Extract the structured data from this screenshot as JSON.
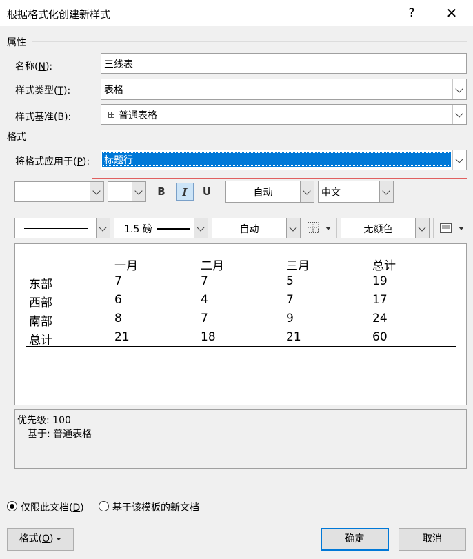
{
  "window": {
    "title": "根据格式化创建新样式",
    "help": "?",
    "close": "✕"
  },
  "properties": {
    "section": "属性",
    "name_label": "名称(",
    "name_key": "N",
    "name_tail": "):",
    "name_value": "三线表",
    "type_label": "样式类型(",
    "type_key": "T",
    "type_tail": "):",
    "type_value": "表格",
    "base_label": "样式基准(",
    "base_key": "B",
    "base_tail": "):",
    "base_value": "普通表格"
  },
  "format": {
    "section": "格式",
    "apply_label": "将格式应用于(",
    "apply_key": "P",
    "apply_tail": "):",
    "apply_value": "标题行",
    "bold": "B",
    "italic": "I",
    "underline": "U",
    "font_color": "自动",
    "script": "中文",
    "border_weight": "1.5 磅",
    "border_color": "自动",
    "shading": "无颜色"
  },
  "preview": {
    "headers": [
      "一月",
      "二月",
      "三月",
      "总计"
    ],
    "rows": [
      [
        "东部",
        "7",
        "7",
        "5",
        "19"
      ],
      [
        "西部",
        "6",
        "4",
        "7",
        "17"
      ],
      [
        "南部",
        "8",
        "7",
        "9",
        "24"
      ],
      [
        "总计",
        "21",
        "18",
        "21",
        "60"
      ]
    ]
  },
  "description": {
    "priority": "优先级: 100",
    "based_on": "基于: 普通表格"
  },
  "options": {
    "this_doc": "仅限此文档(",
    "this_doc_key": "D",
    "this_doc_tail": ")",
    "new_docs": "基于该模板的新文档"
  },
  "buttons": {
    "format": "格式(",
    "format_key": "O",
    "format_tail": ")",
    "ok": "确定",
    "cancel": "取消"
  }
}
